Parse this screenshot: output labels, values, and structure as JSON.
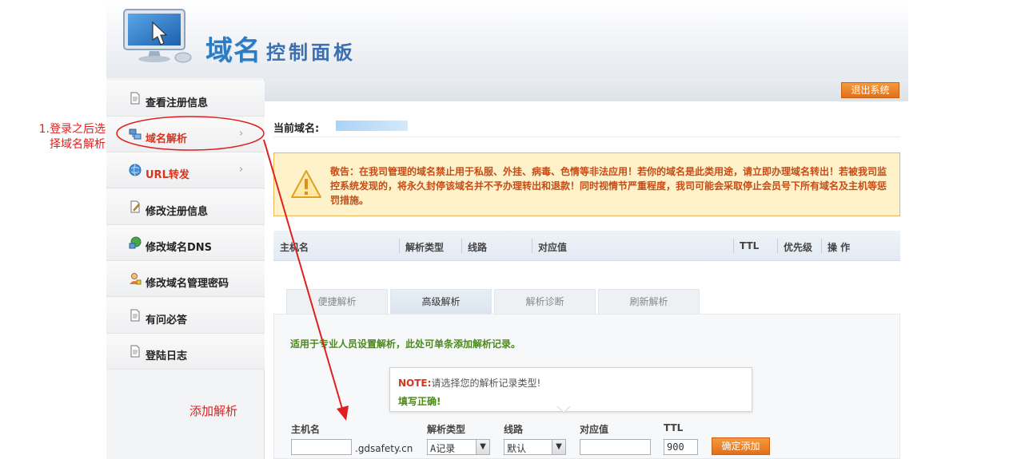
{
  "header": {
    "logo_title": "域名",
    "logo_subtitle": "控制面板"
  },
  "sidebar": {
    "items": [
      {
        "label": "查看注册信息",
        "icon": "document-icon"
      },
      {
        "label": "域名解析",
        "icon": "network-icon",
        "selected": true
      },
      {
        "label": "URL转发",
        "icon": "globe-icon"
      },
      {
        "label": "修改注册信息",
        "icon": "edit-document-icon"
      },
      {
        "label": "修改域名DNS",
        "icon": "dns-globe-icon"
      },
      {
        "label": "修改域名管理密码",
        "icon": "user-lock-icon"
      },
      {
        "label": "有问必答",
        "icon": "document-icon"
      },
      {
        "label": "登陆日志",
        "icon": "document-icon"
      }
    ],
    "chevron": "›"
  },
  "topbar": {
    "logout_label": "退出系统"
  },
  "current_domain": {
    "label": "当前域名:"
  },
  "warning": {
    "text": "敬告：在我司管理的域名禁止用于私服、外挂、病毒、色情等非法应用！若你的域名是此类用途，请立即办理域名转出！若被我司监控系统发现的，将永久封停该域名并不予办理转出和退款！同时视情节严重程度，我司可能会采取停止会员号下所有域名及主机等惩罚措施。"
  },
  "records_table": {
    "headers": [
      "主机名",
      "解析类型",
      "线路",
      "对应值",
      "TTL",
      "优先级",
      "操 作"
    ]
  },
  "tabs": [
    {
      "label": "便捷解析",
      "active": false
    },
    {
      "label": "高级解析",
      "active": true
    },
    {
      "label": "解析诊断",
      "active": false
    },
    {
      "label": "刷新解析",
      "active": false
    }
  ],
  "panel": {
    "description": "适用于专业人员设置解析，此处可单条添加解析记录。"
  },
  "note": {
    "keyword": "NOTE:",
    "message": "请选择您的解析记录类型!",
    "line2": "填写正确!"
  },
  "form": {
    "host_label": "主机名",
    "host_value": "",
    "domain_suffix": ".gdsafety.cn",
    "type_label": "解析类型",
    "type_value": "A记录",
    "line_label": "线路",
    "line_value": "默认",
    "value_label": "对应值",
    "value_value": "",
    "ttl_label": "TTL",
    "ttl_value": "900",
    "submit_label": "确定添加"
  },
  "annotations": {
    "step1": "1.登录之后选择域名解析",
    "step2": "添加解析",
    "color": "#e02020"
  },
  "colors": {
    "accent_orange": "#e0701a",
    "warning_text": "#c94b15",
    "green_text": "#4b8a1a",
    "selected_red": "#d9331c"
  }
}
